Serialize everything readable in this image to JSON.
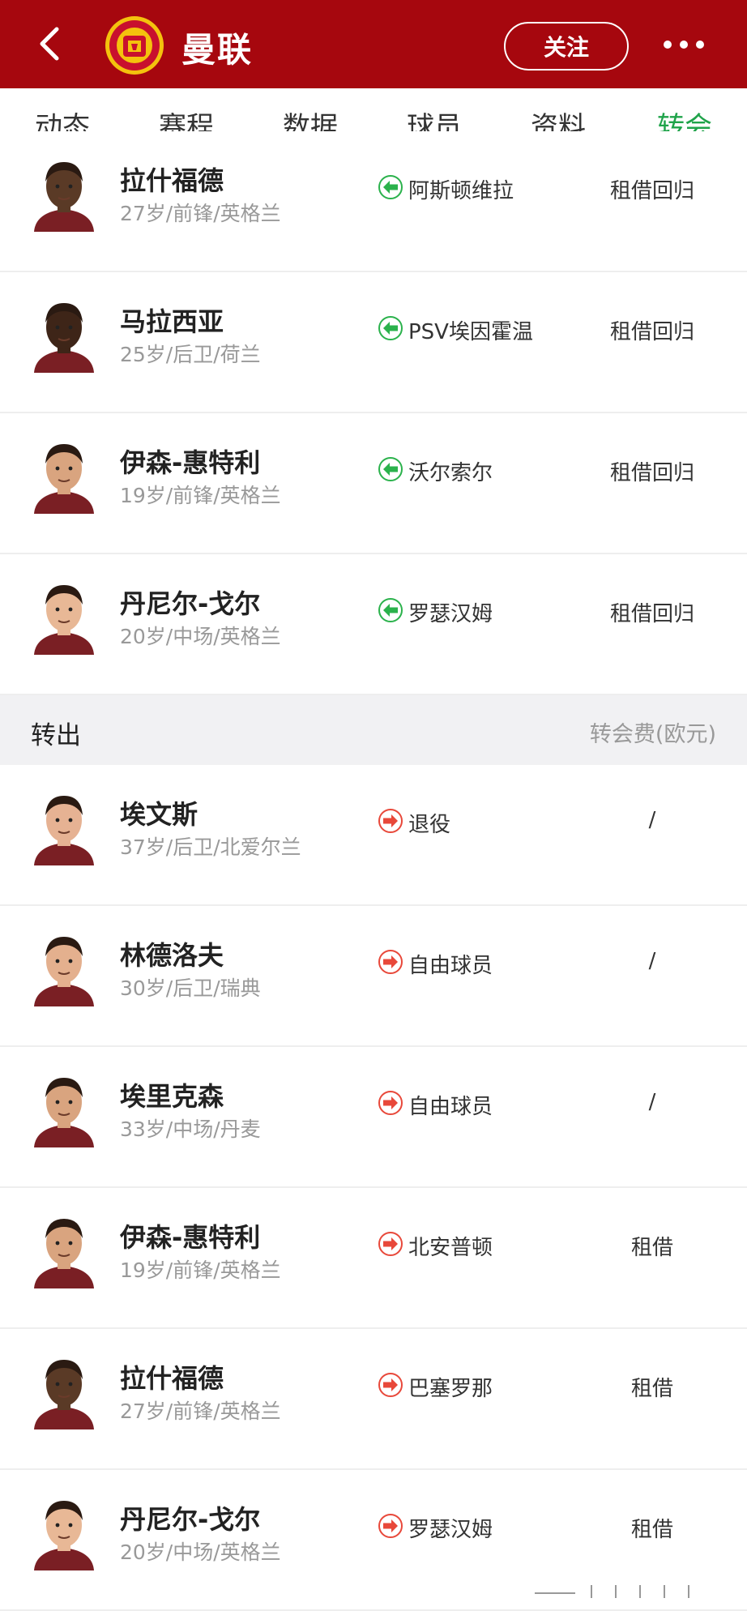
{
  "header": {
    "team_name": "曼联",
    "follow_label": "关注",
    "bg_color": "#a6070e"
  },
  "tabs": [
    {
      "label": "动态"
    },
    {
      "label": "赛程"
    },
    {
      "label": "数据"
    },
    {
      "label": "球员"
    },
    {
      "label": "资料"
    },
    {
      "label": "转会",
      "active": true
    }
  ],
  "incoming": [
    {
      "name": "拉什福德",
      "meta": "27岁/前锋/英格兰",
      "club": "阿斯顿维拉",
      "fee": "租借回归"
    },
    {
      "name": "马拉西亚",
      "meta": "25岁/后卫/荷兰",
      "club": "PSV埃因霍温",
      "fee": "租借回归"
    },
    {
      "name": "伊森-惠特利",
      "meta": "19岁/前锋/英格兰",
      "club": "沃尔索尔",
      "fee": "租借回归"
    },
    {
      "name": "丹尼尔-戈尔",
      "meta": "20岁/中场/英格兰",
      "club": "罗瑟汉姆",
      "fee": "租借回归"
    }
  ],
  "outgoing_section": {
    "title": "转出",
    "fee_header": "转会费(欧元)"
  },
  "outgoing": [
    {
      "name": "埃文斯",
      "meta": "37岁/后卫/北爱尔兰",
      "club": "退役",
      "fee": "/"
    },
    {
      "name": "林德洛夫",
      "meta": "30岁/后卫/瑞典",
      "club": "自由球员",
      "fee": "/"
    },
    {
      "name": "埃里克森",
      "meta": "33岁/中场/丹麦",
      "club": "自由球员",
      "fee": "/"
    },
    {
      "name": "伊森-惠特利",
      "meta": "19岁/前锋/英格兰",
      "club": "北安普顿",
      "fee": "租借"
    },
    {
      "name": "拉什福德",
      "meta": "27岁/前锋/英格兰",
      "club": "巴塞罗那",
      "fee": "租借"
    },
    {
      "name": "丹尼尔-戈尔",
      "meta": "20岁/中场/英格兰",
      "club": "罗瑟汉姆",
      "fee": "租借"
    }
  ],
  "colors": {
    "accent_green": "#1fa34a",
    "in_arrow": "#2bb24c",
    "out_arrow": "#e8483a"
  },
  "icons": {
    "back": "back-arrow-icon",
    "logo": "club-crest-icon",
    "more": "more-dots-icon",
    "in": "arrow-left-in-icon",
    "out": "arrow-right-out-icon"
  }
}
